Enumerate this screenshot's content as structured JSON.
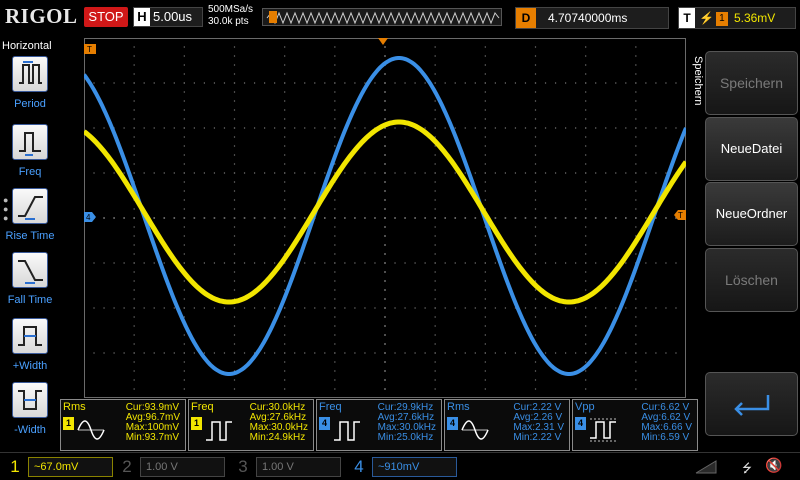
{
  "topbar": {
    "brand": "RIGOL",
    "run_status": "STOP",
    "timebase_key": "H",
    "timebase_value": "5.00us",
    "sample_rate": "500MSa/s",
    "memory_depth": "30.0k pts",
    "delay_key": "D",
    "delay_value": "4.70740000ms",
    "trigger_key": "T",
    "trigger_source": "1",
    "trigger_level": "5.36mV"
  },
  "left_menu": {
    "title": "Horizontal",
    "items": [
      {
        "label": "Period",
        "icon": "period-pulse-icon"
      },
      {
        "label": "Freq",
        "icon": "freq-pulse-icon"
      },
      {
        "label": "Rise Time",
        "icon": "rise-edge-icon"
      },
      {
        "label": "Fall Time",
        "icon": "fall-edge-icon"
      },
      {
        "label": "+Width",
        "icon": "positive-width-icon"
      },
      {
        "label": "-Width",
        "icon": "negative-width-icon"
      }
    ]
  },
  "right_menu": {
    "title": "Speichern",
    "buttons": [
      {
        "label": "Speichern",
        "enabled": false
      },
      {
        "label": "NeueDatei",
        "enabled": true
      },
      {
        "label": "NeueOrdner",
        "enabled": true
      },
      {
        "label": "Löschen",
        "enabled": false
      }
    ],
    "return_icon": "return-arrow-icon"
  },
  "markers": {
    "ch4_offset": "4",
    "trigger_position": "T",
    "trigger_level": "T"
  },
  "measurements": [
    {
      "name": "Rms",
      "channel": "1",
      "cur": "Cur:93.9mV",
      "avg": "Avg:96.7mV",
      "max": "Max:100mV",
      "min": "Min:93.7mV"
    },
    {
      "name": "Freq",
      "channel": "1",
      "cur": "Cur:30.0kHz",
      "avg": "Avg:27.6kHz",
      "max": "Max:30.0kHz",
      "min": "Min:24.9kHz"
    },
    {
      "name": "Freq",
      "channel": "4",
      "cur": "Cur:29.9kHz",
      "avg": "Avg:27.6kHz",
      "max": "Max:30.0kHz",
      "min": "Min:25.0kHz"
    },
    {
      "name": "Rms",
      "channel": "4",
      "cur": "Cur:2.22 V",
      "avg": "Avg:2.26 V",
      "max": "Max:2.31 V",
      "min": "Min:2.22 V"
    },
    {
      "name": "Vpp",
      "channel": "4",
      "cur": "Cur:6.62 V",
      "avg": "Avg:6.62 V",
      "max": "Max:6.66 V",
      "min": "Min:6.59 V"
    }
  ],
  "channels": [
    {
      "num": "1",
      "setting": "~67.0mV",
      "active": true
    },
    {
      "num": "2",
      "setting": "1.00 V",
      "active": false
    },
    {
      "num": "3",
      "setting": "1.00 V",
      "active": false
    },
    {
      "num": "4",
      "setting": "~910mV",
      "active": true
    }
  ],
  "colors": {
    "ch1": "#f2e600",
    "ch4": "#3a8fe6",
    "trigger": "#e67e00",
    "stop": "#d01818"
  }
}
